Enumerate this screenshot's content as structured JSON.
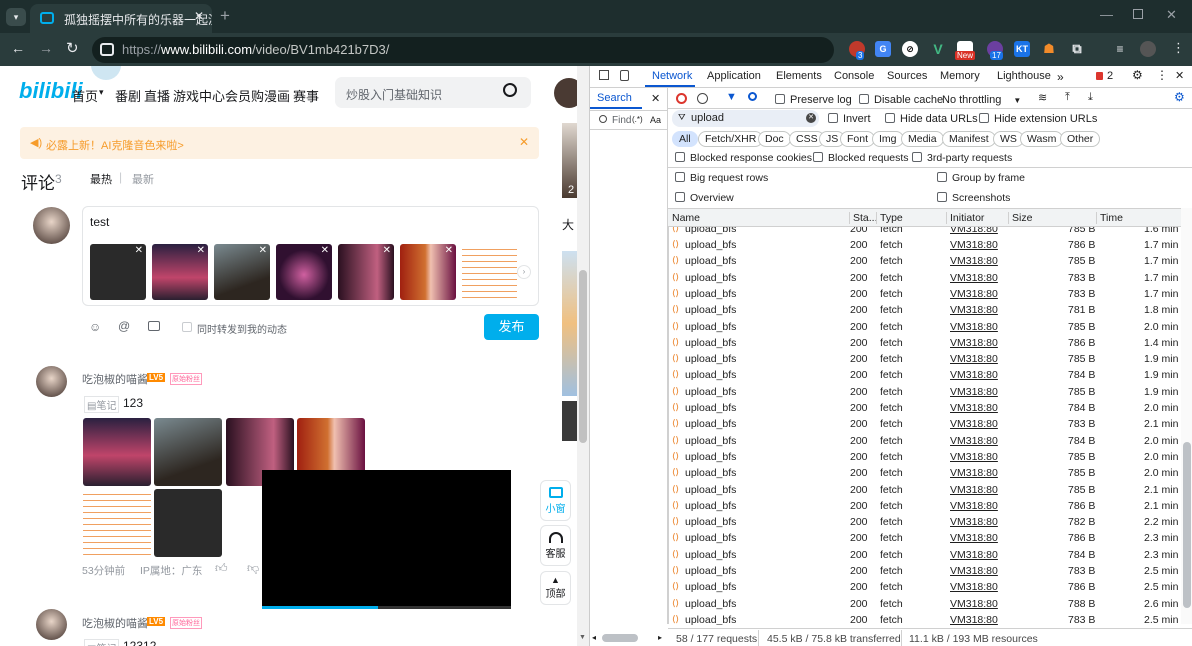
{
  "browser": {
    "tab_title": "孤独摇摆中所有的乐器一起演奏",
    "url_prefix": "https://",
    "url_host": "www.bilibili.com",
    "url_path": "/video/BV1mb421b7D3/",
    "ext_new_badge": "New",
    "ext_count_3": "3",
    "ext_count_17": "17",
    "ext_kt": "KT"
  },
  "bili": {
    "logo": "bilibili",
    "nav": [
      "首页",
      "番剧",
      "直播",
      "游戏中心",
      "会员购",
      "漫画",
      "赛事"
    ],
    "search_placeholder": "炒股入门基础知识",
    "banner": "必露上新！AI克隆音色来啦>",
    "comments_title": "评论",
    "comments_count": "3",
    "sort_hot": "最热",
    "sort_new": "最新",
    "compose_text": "test",
    "sync_label": "同时转发到我的动态",
    "publish_label": "发布",
    "comment1": {
      "user": "吃泡椒的喵酱",
      "level": "LV5",
      "badge": "原始粉丝",
      "note_label": "笔记",
      "text": "123",
      "time": "53分钟前",
      "ip": "IP属地：广东"
    },
    "comment2": {
      "user": "吃泡椒的喵酱",
      "level": "LV5",
      "badge": "原始粉丝",
      "note_label": "笔记",
      "text": "12312"
    },
    "side_mini": "小窗",
    "side_service": "客服",
    "side_top": "顶部",
    "right_cut_text": "大",
    "right_cut_num": "2"
  },
  "devtools": {
    "tabs": [
      "Network",
      "Application",
      "Elements",
      "Console",
      "Sources",
      "Memory",
      "Lighthouse"
    ],
    "issues_count": "2",
    "search_tab": "Search",
    "find_placeholder": "Find",
    "aa_label": "Aa",
    "preserve_log": "Preserve log",
    "disable_cache": "Disable cache",
    "throttling": "No throttling",
    "filter_value": "upload",
    "invert": "Invert",
    "hide_data_urls": "Hide data URLs",
    "hide_ext_urls": "Hide extension URLs",
    "filters": [
      "All",
      "Fetch/XHR",
      "Doc",
      "CSS",
      "JS",
      "Font",
      "Img",
      "Media",
      "Manifest",
      "WS",
      "Wasm",
      "Other"
    ],
    "blocked_cookies": "Blocked response cookies",
    "blocked_requests": "Blocked requests",
    "third_party": "3rd-party requests",
    "big_rows": "Big request rows",
    "group_by_frame": "Group by frame",
    "overview": "Overview",
    "screenshots": "Screenshots",
    "columns": {
      "name": "Name",
      "status": "Sta...",
      "type": "Type",
      "initiator": "Initiator",
      "size": "Size",
      "time": "Time"
    },
    "rows": [
      {
        "name": "upload_bfs",
        "status": "200",
        "type": "fetch",
        "initiator": "VM318:80",
        "size": "786 B",
        "time": "1.7 min"
      },
      {
        "name": "upload_bfs",
        "status": "200",
        "type": "fetch",
        "initiator": "VM318:80",
        "size": "785 B",
        "time": "1.7 min"
      },
      {
        "name": "upload_bfs",
        "status": "200",
        "type": "fetch",
        "initiator": "VM318:80",
        "size": "783 B",
        "time": "1.7 min"
      },
      {
        "name": "upload_bfs",
        "status": "200",
        "type": "fetch",
        "initiator": "VM318:80",
        "size": "783 B",
        "time": "1.7 min"
      },
      {
        "name": "upload_bfs",
        "status": "200",
        "type": "fetch",
        "initiator": "VM318:80",
        "size": "781 B",
        "time": "1.8 min"
      },
      {
        "name": "upload_bfs",
        "status": "200",
        "type": "fetch",
        "initiator": "VM318:80",
        "size": "785 B",
        "time": "2.0 min"
      },
      {
        "name": "upload_bfs",
        "status": "200",
        "type": "fetch",
        "initiator": "VM318:80",
        "size": "786 B",
        "time": "1.4 min"
      },
      {
        "name": "upload_bfs",
        "status": "200",
        "type": "fetch",
        "initiator": "VM318:80",
        "size": "785 B",
        "time": "1.9 min"
      },
      {
        "name": "upload_bfs",
        "status": "200",
        "type": "fetch",
        "initiator": "VM318:80",
        "size": "784 B",
        "time": "1.9 min"
      },
      {
        "name": "upload_bfs",
        "status": "200",
        "type": "fetch",
        "initiator": "VM318:80",
        "size": "785 B",
        "time": "1.9 min"
      },
      {
        "name": "upload_bfs",
        "status": "200",
        "type": "fetch",
        "initiator": "VM318:80",
        "size": "784 B",
        "time": "2.0 min"
      },
      {
        "name": "upload_bfs",
        "status": "200",
        "type": "fetch",
        "initiator": "VM318:80",
        "size": "783 B",
        "time": "2.1 min"
      },
      {
        "name": "upload_bfs",
        "status": "200",
        "type": "fetch",
        "initiator": "VM318:80",
        "size": "784 B",
        "time": "2.0 min"
      },
      {
        "name": "upload_bfs",
        "status": "200",
        "type": "fetch",
        "initiator": "VM318:80",
        "size": "785 B",
        "time": "2.0 min"
      },
      {
        "name": "upload_bfs",
        "status": "200",
        "type": "fetch",
        "initiator": "VM318:80",
        "size": "785 B",
        "time": "2.0 min"
      },
      {
        "name": "upload_bfs",
        "status": "200",
        "type": "fetch",
        "initiator": "VM318:80",
        "size": "785 B",
        "time": "2.1 min"
      },
      {
        "name": "upload_bfs",
        "status": "200",
        "type": "fetch",
        "initiator": "VM318:80",
        "size": "786 B",
        "time": "2.1 min"
      },
      {
        "name": "upload_bfs",
        "status": "200",
        "type": "fetch",
        "initiator": "VM318:80",
        "size": "782 B",
        "time": "2.2 min"
      },
      {
        "name": "upload_bfs",
        "status": "200",
        "type": "fetch",
        "initiator": "VM318:80",
        "size": "786 B",
        "time": "2.3 min"
      },
      {
        "name": "upload_bfs",
        "status": "200",
        "type": "fetch",
        "initiator": "VM318:80",
        "size": "784 B",
        "time": "2.3 min"
      },
      {
        "name": "upload_bfs",
        "status": "200",
        "type": "fetch",
        "initiator": "VM318:80",
        "size": "783 B",
        "time": "2.5 min"
      },
      {
        "name": "upload_bfs",
        "status": "200",
        "type": "fetch",
        "initiator": "VM318:80",
        "size": "786 B",
        "time": "2.5 min"
      },
      {
        "name": "upload_bfs",
        "status": "200",
        "type": "fetch",
        "initiator": "VM318:80",
        "size": "788 B",
        "time": "2.6 min"
      },
      {
        "name": "upload_bfs",
        "status": "200",
        "type": "fetch",
        "initiator": "VM318:80",
        "size": "783 B",
        "time": "2.5 min"
      }
    ],
    "partial_row": {
      "name": "upload_bfs",
      "status": "200",
      "type": "fetch",
      "initiator": "VM318:80",
      "size": "785 B",
      "time": "1.6 min"
    },
    "status_requests": "58 / 177 requests",
    "status_transferred": "45.5 kB / 75.8 kB transferred",
    "status_resources": "11.1 kB / 193 MB resources"
  }
}
